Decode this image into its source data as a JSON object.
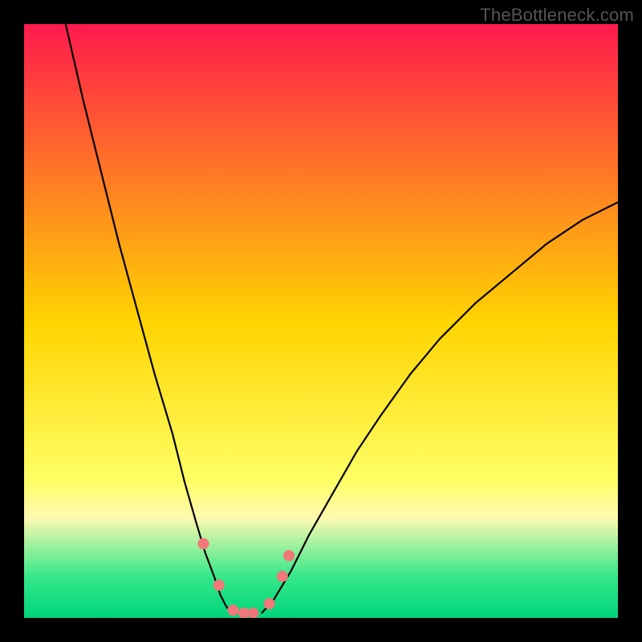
{
  "watermark": "TheBottleneck.com",
  "chart_data": {
    "type": "line",
    "title": "",
    "xlabel": "",
    "ylabel": "",
    "xlim": [
      0,
      100
    ],
    "ylim": [
      0,
      100
    ],
    "grid": false,
    "legend": false,
    "background_gradient": {
      "stops": [
        {
          "offset": 0.0,
          "color": "#ff1a4d"
        },
        {
          "offset": 0.5,
          "color": "#ffd400"
        },
        {
          "offset": 0.77,
          "color": "#ffff66"
        },
        {
          "offset": 0.83,
          "color": "#fff9b0"
        },
        {
          "offset": 0.93,
          "color": "#36e88a"
        },
        {
          "offset": 1.0,
          "color": "#00d47a"
        }
      ]
    },
    "series": [
      {
        "name": "left-branch",
        "stroke": "#000000",
        "x": [
          7,
          10,
          13,
          16,
          19,
          22,
          25,
          27,
          29,
          30.5,
          32,
          33,
          34,
          35
        ],
        "y": [
          100,
          87,
          75,
          63,
          52,
          41,
          31,
          23,
          16,
          11,
          7,
          4,
          2,
          0.8
        ]
      },
      {
        "name": "right-branch",
        "stroke": "#000000",
        "x": [
          40,
          42,
          45,
          48,
          52,
          56,
          60,
          65,
          70,
          76,
          82,
          88,
          94,
          100
        ],
        "y": [
          0.8,
          3,
          8,
          14,
          21,
          28,
          34,
          41,
          47,
          53,
          58,
          63,
          67,
          70
        ]
      }
    ],
    "marker_series": {
      "name": "highlight-points",
      "color": "#f07878",
      "radius_px": 7,
      "points": [
        {
          "x": 30.2,
          "y": 12.5
        },
        {
          "x": 32.8,
          "y": 5.5
        },
        {
          "x": 35.2,
          "y": 1.3
        },
        {
          "x": 37.0,
          "y": 0.8
        },
        {
          "x": 38.6,
          "y": 0.8
        },
        {
          "x": 41.3,
          "y": 2.4
        },
        {
          "x": 43.5,
          "y": 7.0
        },
        {
          "x": 44.6,
          "y": 10.5
        }
      ]
    }
  }
}
